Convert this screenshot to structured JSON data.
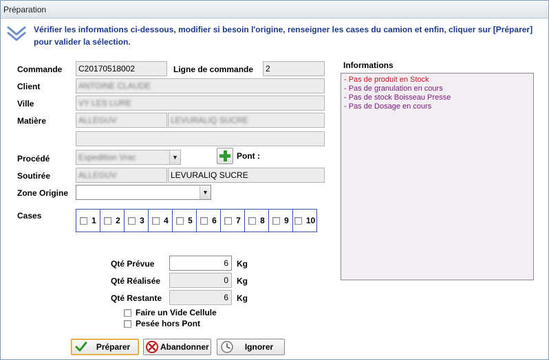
{
  "window": {
    "title": "Préparation"
  },
  "instruction": "Vérifier les informations ci-dessous, modifier si besoin l'origine, renseigner les cases du camion et enfin, cliquer sur [Préparer] pour valider la sélection.",
  "form": {
    "commande": {
      "label": "Commande",
      "value": "C20170518002"
    },
    "ligne_commande": {
      "label": "Ligne de commande",
      "value": "2"
    },
    "client": {
      "label": "Client",
      "value": "ANTOINE CLAUDE"
    },
    "ville": {
      "label": "Ville",
      "value": "VY LES LURE"
    },
    "matiere": {
      "label": "Matière",
      "value1": "ALLEGUV",
      "value2": "LEVURALIQ SUCRE",
      "value3": ""
    },
    "procede": {
      "label": "Procédé",
      "value": "Expedition Vrac"
    },
    "pont": {
      "label": "Pont :"
    },
    "soutiree": {
      "label": "Soutirée",
      "value1": "ALLEGUV",
      "value2": "LEVURALIQ SUCRE"
    },
    "zone_origine": {
      "label": "Zone Origine",
      "value": ""
    },
    "cases": {
      "label": "Cases",
      "items": [
        "1",
        "2",
        "3",
        "4",
        "5",
        "6",
        "7",
        "8",
        "9",
        "10"
      ]
    }
  },
  "quantities": {
    "prevue": {
      "label": "Qté Prévue",
      "value": "6",
      "unit": "Kg"
    },
    "realisee": {
      "label": "Qté Réalisée",
      "value": "0",
      "unit": "Kg"
    },
    "restante": {
      "label": "Qté Restante",
      "value": "6",
      "unit": "Kg"
    }
  },
  "options": {
    "vide_cellule": "Faire un Vide Cellule",
    "pesee_hors_pont": "Pesée hors Pont"
  },
  "buttons": {
    "preparer": "Préparer",
    "abandonner": "Abandonner",
    "ignorer": "Ignorer"
  },
  "informations": {
    "title": "Informations",
    "lines": [
      "- Pas de produit en Stock",
      "- Pas de granulation en cours",
      "- Pas de stock Boisseau Presse",
      "- Pas de Dosage en cours"
    ]
  },
  "colors": {
    "instruction": "#1e3a8a",
    "cases_border": "#3355aa",
    "info_first": "#c0181f",
    "info_other": "#7a1a78"
  }
}
